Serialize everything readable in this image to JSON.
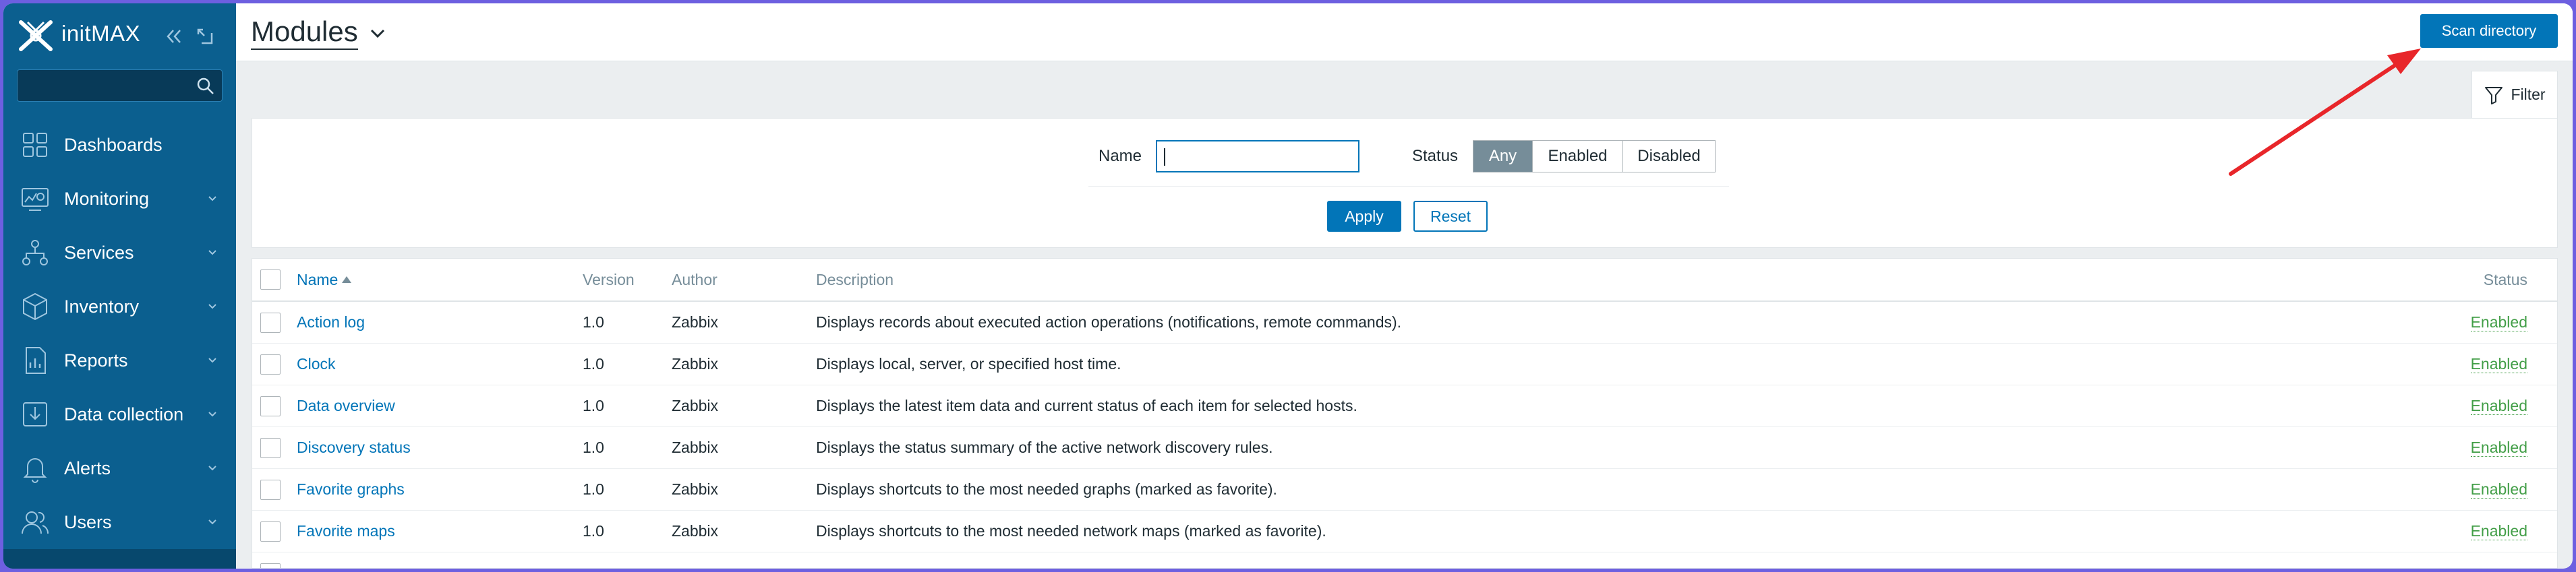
{
  "app": {
    "brand": "initMAX",
    "search_placeholder": ""
  },
  "sidebar": {
    "items": [
      {
        "label": "Dashboards",
        "icon": "dashboard-icon"
      },
      {
        "label": "Monitoring",
        "icon": "monitoring-icon"
      },
      {
        "label": "Services",
        "icon": "services-icon"
      },
      {
        "label": "Inventory",
        "icon": "inventory-icon"
      },
      {
        "label": "Reports",
        "icon": "reports-icon"
      },
      {
        "label": "Data collection",
        "icon": "data-collection-icon"
      },
      {
        "label": "Alerts",
        "icon": "alerts-icon"
      },
      {
        "label": "Users",
        "icon": "users-icon"
      }
    ]
  },
  "header": {
    "title": "Modules",
    "scan_button": "Scan directory"
  },
  "filter": {
    "tab_label": "Filter",
    "name_label": "Name",
    "name_value": "",
    "status_label": "Status",
    "status_options": [
      "Any",
      "Enabled",
      "Disabled"
    ],
    "status_selected": "Any",
    "apply_label": "Apply",
    "reset_label": "Reset"
  },
  "table": {
    "columns": {
      "name": "Name",
      "version": "Version",
      "author": "Author",
      "description": "Description",
      "status": "Status"
    },
    "sort_column": "Name",
    "rows": [
      {
        "name": "Action log",
        "version": "1.0",
        "author": "Zabbix",
        "description": "Displays records about executed action operations (notifications, remote commands).",
        "status": "Enabled"
      },
      {
        "name": "Clock",
        "version": "1.0",
        "author": "Zabbix",
        "description": "Displays local, server, or specified host time.",
        "status": "Enabled"
      },
      {
        "name": "Data overview",
        "version": "1.0",
        "author": "Zabbix",
        "description": "Displays the latest item data and current status of each item for selected hosts.",
        "status": "Enabled"
      },
      {
        "name": "Discovery status",
        "version": "1.0",
        "author": "Zabbix",
        "description": "Displays the status summary of the active network discovery rules.",
        "status": "Enabled"
      },
      {
        "name": "Favorite graphs",
        "version": "1.0",
        "author": "Zabbix",
        "description": "Displays shortcuts to the most needed graphs (marked as favorite).",
        "status": "Enabled"
      },
      {
        "name": "Favorite maps",
        "version": "1.0",
        "author": "Zabbix",
        "description": "Displays shortcuts to the most needed network maps (marked as favorite).",
        "status": "Enabled"
      }
    ]
  },
  "colors": {
    "sidebar": "#0b5f8f",
    "primary": "#0275b8",
    "enabled": "#429e47",
    "annotation_arrow": "#e8262a",
    "frame": "#6d5fe0"
  }
}
